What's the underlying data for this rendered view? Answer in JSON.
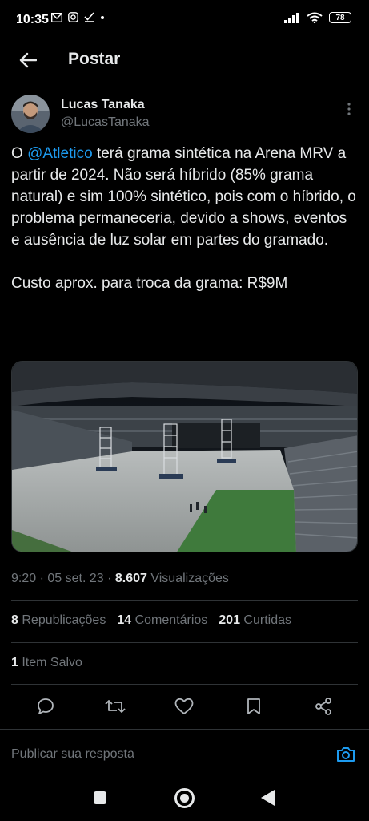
{
  "status_bar": {
    "time": "10:35",
    "battery": "78"
  },
  "header": {
    "title": "Postar"
  },
  "author": {
    "name": "Lucas Tanaka",
    "handle": "@LucasTanaka"
  },
  "tweet": {
    "prefix": "O ",
    "mention": "@Atletico",
    "body": " terá grama sintética na Arena MRV a partir de 2024. Não será híbrido (85% grama natural) e sim 100% sintético, pois com o híbrido, o problema permaneceria, devido a shows, eventos e ausência de luz solar em partes do gramado.\n\nCusto aprox. para troca da grama: R$9M"
  },
  "meta": {
    "time": "9:20",
    "date": "05 set. 23",
    "views_count": "8.607",
    "views_label": "Visualizações"
  },
  "stats": {
    "reposts_count": "8",
    "reposts_label": "Republicações",
    "comments_count": "14",
    "comments_label": "Comentários",
    "likes_count": "201",
    "likes_label": "Curtidas"
  },
  "saved": {
    "count": "1",
    "label": "Item Salvo"
  },
  "reply": {
    "placeholder": "Publicar sua resposta"
  },
  "colors": {
    "accent": "#1d9bf0",
    "background": "#000000",
    "text": "#e7e9ea",
    "muted": "#71767b",
    "border": "#2f3336"
  }
}
